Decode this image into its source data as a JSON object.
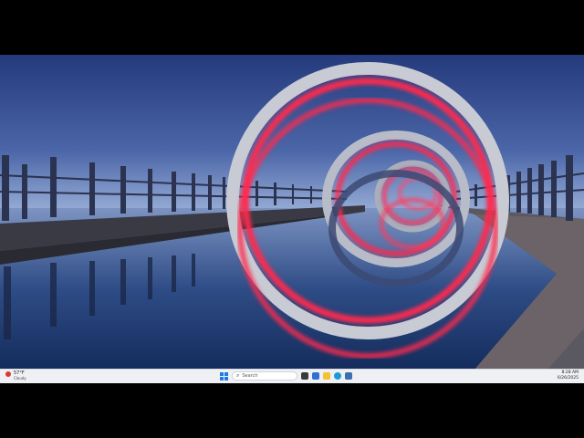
{
  "taskbar": {
    "weather": {
      "temperature": "57°F",
      "condition": "Cloudy",
      "icon": "weather-icon"
    },
    "search": {
      "placeholder": "Search"
    },
    "pinned": [
      {
        "name": "task-view-icon",
        "color": "#3a3a3a"
      },
      {
        "name": "widgets-icon",
        "color": "#2f6fd6"
      },
      {
        "name": "file-explorer-icon",
        "color": "#f2c230"
      },
      {
        "name": "edge-icon",
        "color": "#1a9bd8"
      },
      {
        "name": "store-icon",
        "color": "#3b6fb0"
      }
    ],
    "clock": {
      "time": "8:28 AM",
      "date": "6/26/2025"
    }
  },
  "colors": {
    "sky_top": "#243a7c",
    "sky_bottom": "#9ab0d8",
    "ring_glow": "#ff2a4d",
    "water": "#1b3a6e"
  }
}
